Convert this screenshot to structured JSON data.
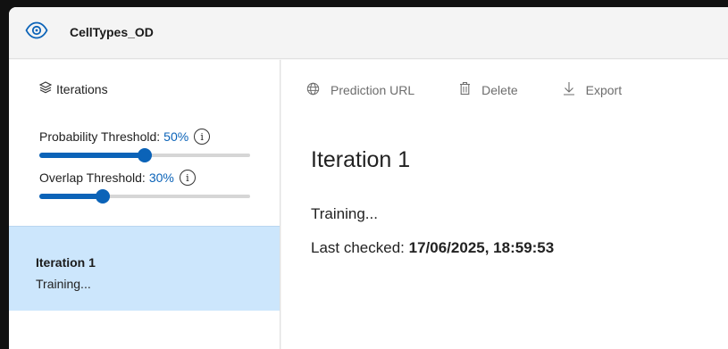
{
  "app": {
    "project_name": "CellTypes_OD",
    "project_icon": "eye-icon",
    "accent_color": "#0b63b8",
    "selected_bg": "#cce6fc"
  },
  "sidebar": {
    "header": "Iterations",
    "probability_threshold": {
      "label": "Probability Threshold:",
      "value_text": "50%",
      "value": 0.5
    },
    "overlap_threshold": {
      "label": "Overlap Threshold:",
      "value_text": "30%",
      "value": 0.3
    },
    "iterations": [
      {
        "name": "Iteration 1",
        "status": "Training..."
      }
    ]
  },
  "toolbar": {
    "prediction_url": "Prediction URL",
    "delete": "Delete",
    "export": "Export"
  },
  "main": {
    "title": "Iteration 1",
    "status": "Training...",
    "last_checked_label": "Last checked:",
    "last_checked_value": "17/06/2025, 18:59:53"
  }
}
